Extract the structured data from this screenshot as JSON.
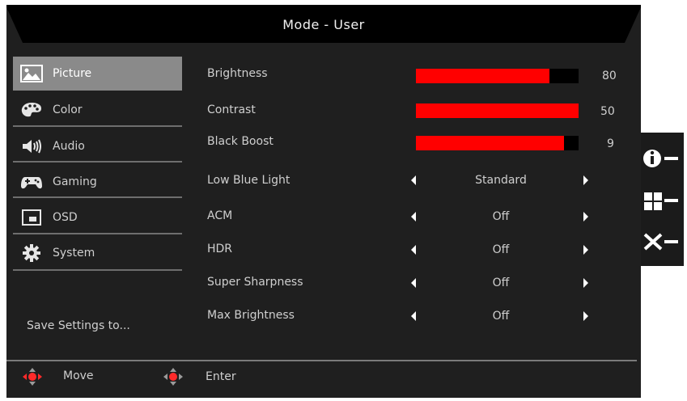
{
  "header": {
    "title": "Mode - User"
  },
  "menu": {
    "items": [
      {
        "label": "Picture",
        "icon": "picture-icon",
        "active": true
      },
      {
        "label": "Color",
        "icon": "palette-icon",
        "active": false
      },
      {
        "label": "Audio",
        "icon": "speaker-icon",
        "active": false
      },
      {
        "label": "Gaming",
        "icon": "gamepad-icon",
        "active": false
      },
      {
        "label": "OSD",
        "icon": "osd-icon",
        "active": false
      },
      {
        "label": "System",
        "icon": "gear-icon",
        "active": false
      }
    ],
    "save_label": "Save Settings to..."
  },
  "sliders": [
    {
      "label": "Brightness",
      "value": "80",
      "fill_fraction": 0.82
    },
    {
      "label": "Contrast",
      "value": "50",
      "fill_fraction": 1.0
    },
    {
      "label": "Black Boost",
      "value": "9",
      "fill_fraction": 0.91
    }
  ],
  "options": [
    {
      "label": "Low Blue Light",
      "value": "Standard"
    },
    {
      "label": "ACM",
      "value": "Off"
    },
    {
      "label": "HDR",
      "value": "Off"
    },
    {
      "label": "Super Sharpness",
      "value": "Off"
    },
    {
      "label": "Max Brightness",
      "value": "Off"
    }
  ],
  "footer": {
    "move_label": "Move",
    "enter_label": "Enter"
  },
  "side_buttons": [
    "info-button-icon",
    "input-button-icon",
    "exit-button-icon"
  ],
  "colors": {
    "accent": "#ff0000",
    "panel_bg": "#1f1f1f",
    "active_bg": "#8a8a8a"
  }
}
